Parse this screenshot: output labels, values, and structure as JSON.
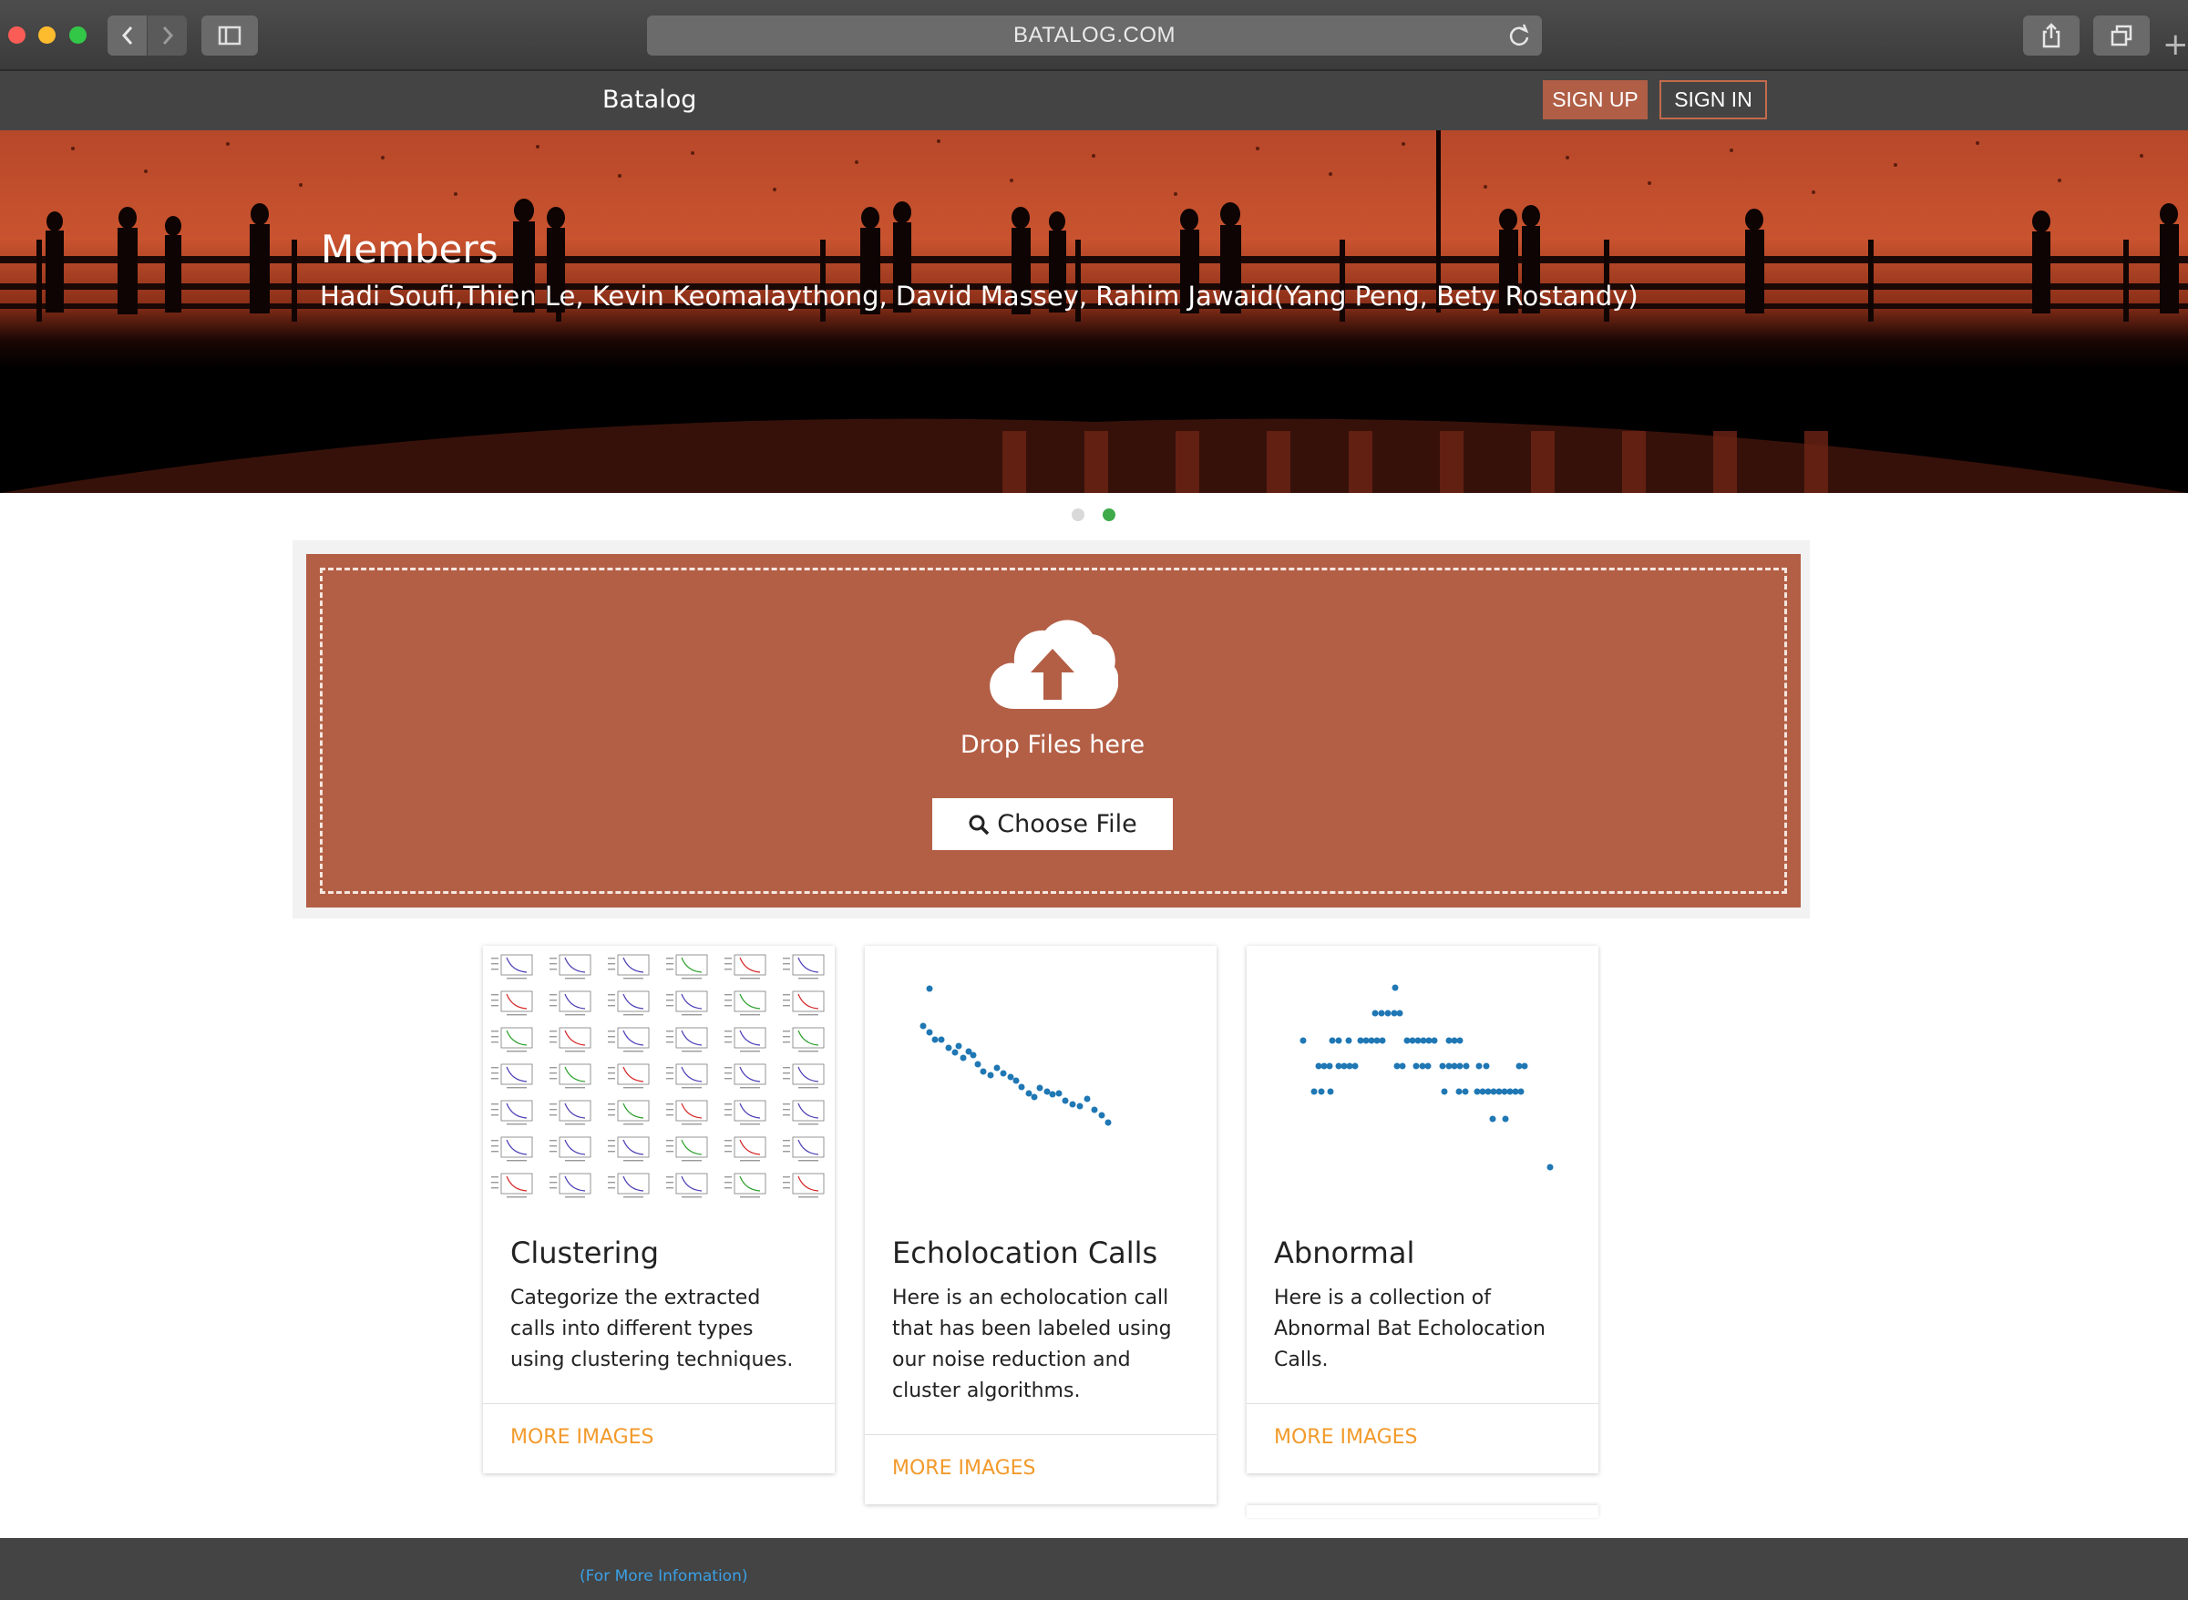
{
  "browser": {
    "url": "BATALOG.COM"
  },
  "navbar": {
    "brand": "Batalog",
    "signup_label": "SIGN UP",
    "signin_label": "SIGN IN"
  },
  "hero": {
    "title": "Members",
    "subtitle": "Hadi Soufi,Thien Le, Kevin Keomalaythong, David Massey, Rahim Jawaid(Yang Peng, Bety Rostandy)",
    "active_slide": 2,
    "slide_count": 2
  },
  "upload": {
    "drop_text": "Drop Files here",
    "choose_label": "Choose File"
  },
  "cards": [
    {
      "title": "Clustering",
      "text": "Categorize the extracted calls into different types using clustering techniques.",
      "link": "MORE IMAGES"
    },
    {
      "title": "Echolocation Calls",
      "text": "Here is an echolocation call that has been labeled using our noise reduction and cluster algorithms.",
      "link": "MORE IMAGES"
    },
    {
      "title": "Abnormal",
      "text": "Here is a collection of Abnormal Bat Echolocation Calls.",
      "link": "MORE IMAGES"
    }
  ],
  "footer": {
    "link": "(For More Infomation)"
  },
  "colors": {
    "accent": "#b35f45",
    "link": "#f29a2b",
    "active_dot": "#3eaa4a"
  }
}
